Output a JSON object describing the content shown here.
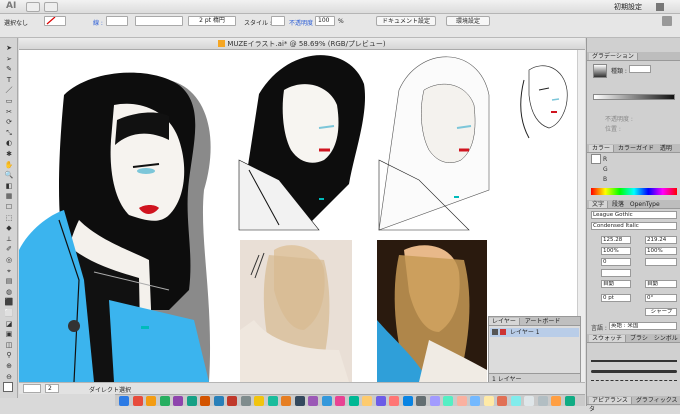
{
  "appbar": {
    "app_label": "AI",
    "workspace": "初期設定"
  },
  "control": {
    "selection": "選択なし",
    "stroke_label": "線 :",
    "stroke_preset": "2 pt 楕円",
    "style_label": "スタイル :",
    "opacity_label": "不透明度",
    "opacity_value": "100",
    "opacity_unit": "%",
    "doc_setup": "ドキュメント設定",
    "preferences": "環境設定"
  },
  "document": {
    "title": "MUZEイラスト.ai* @ 58.69% (RGB/プレビュー)",
    "zoom": "58.69%",
    "artboard": "2",
    "tool_name": "ダイレクト選択"
  },
  "panels": {
    "gradient": {
      "tab": "グラデーション",
      "type_label": "種類 :",
      "opacity_label": "不透明度 :",
      "position_label": "位置 :"
    },
    "color": {
      "tabs": [
        "カラー",
        "カラーガイド",
        "透明"
      ],
      "channels": [
        "R",
        "G",
        "B"
      ]
    },
    "type": {
      "tabs": [
        "文字",
        "段落",
        "OpenType"
      ],
      "font": "League Gothic",
      "style": "Condensed Italic",
      "size": "125.28",
      "leading": "219.24",
      "tracking_a": "100%",
      "tracking_b": "100%",
      "kern": "0",
      "auto_label": "自動",
      "auto_label2": "自動",
      "pt": "0 pt",
      "deg": "0°",
      "lang_label": "言語 :",
      "lang": "英語 : 米国",
      "sharp": "シャープ"
    },
    "swatch": {
      "tabs": [
        "スウォッチ",
        "ブラシ",
        "シンボル"
      ]
    },
    "appearance": {
      "tabs": [
        "アピアランス",
        "グラフィックスタ"
      ]
    }
  },
  "layers": {
    "tabs": [
      "レイヤー",
      "アートボード"
    ],
    "layer_name": "レイヤー 1",
    "count": "1 レイヤー"
  },
  "colors": {
    "canvas_bg": "#ffffff",
    "jacket": "#3bb4ee",
    "lips": "#d0141f",
    "hair": "#111111"
  }
}
